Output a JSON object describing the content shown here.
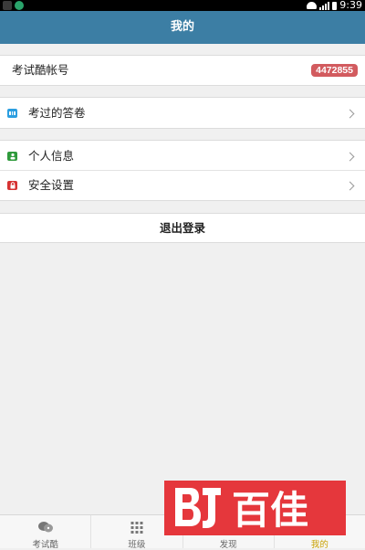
{
  "status_bar": {
    "time": "9:39"
  },
  "header": {
    "title": "我的"
  },
  "account": {
    "label": "考试酷帐号",
    "number": "4472855"
  },
  "menu": {
    "answered": {
      "label": "考过的答卷",
      "icon": "answer-sheet-icon"
    },
    "profile": {
      "label": "个人信息",
      "icon": "person-icon"
    },
    "security": {
      "label": "安全设置",
      "icon": "lock-icon"
    }
  },
  "logout": {
    "label": "退出登录"
  },
  "tabs": [
    {
      "label": "考试酷",
      "icon": "chat-bubble-icon",
      "active": false
    },
    {
      "label": "班级",
      "icon": "grid-icon",
      "active": false
    },
    {
      "label": "发现",
      "icon": "compass-icon",
      "active": false
    },
    {
      "label": "我的",
      "icon": "person-icon",
      "active": true
    }
  ],
  "watermark": {
    "text": "百佳"
  },
  "colors": {
    "header": "#3c7ea4",
    "badge": "#d25b5f",
    "active_tab": "#c8a000",
    "watermark": "#e5373c"
  }
}
